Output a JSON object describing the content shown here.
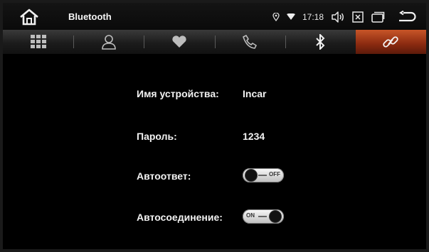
{
  "statusbar": {
    "title": "Bluetooth",
    "time": "17:18",
    "icons": [
      "home-icon",
      "location-icon",
      "wifi-icon",
      "volume-icon",
      "close-box-icon",
      "recent-apps-icon",
      "back-icon"
    ]
  },
  "tabs": [
    {
      "icon": "apps-grid-icon",
      "active": false
    },
    {
      "icon": "contact-icon",
      "active": false
    },
    {
      "icon": "heart-icon",
      "active": false
    },
    {
      "icon": "phone-icon",
      "active": false
    },
    {
      "icon": "bluetooth-icon",
      "active": false
    },
    {
      "icon": "link-icon",
      "active": true
    }
  ],
  "settings": {
    "device_name_label": "Имя устройства:",
    "device_name_value": "Incar",
    "password_label": "Пароль:",
    "password_value": "1234",
    "autoanswer_label": "Автоответ:",
    "autoanswer_state": "OFF",
    "autoconnect_label": "Автосоединение:",
    "autoconnect_state": "ON"
  },
  "colors": {
    "active_tab": "#b8441c",
    "background": "#000000"
  }
}
